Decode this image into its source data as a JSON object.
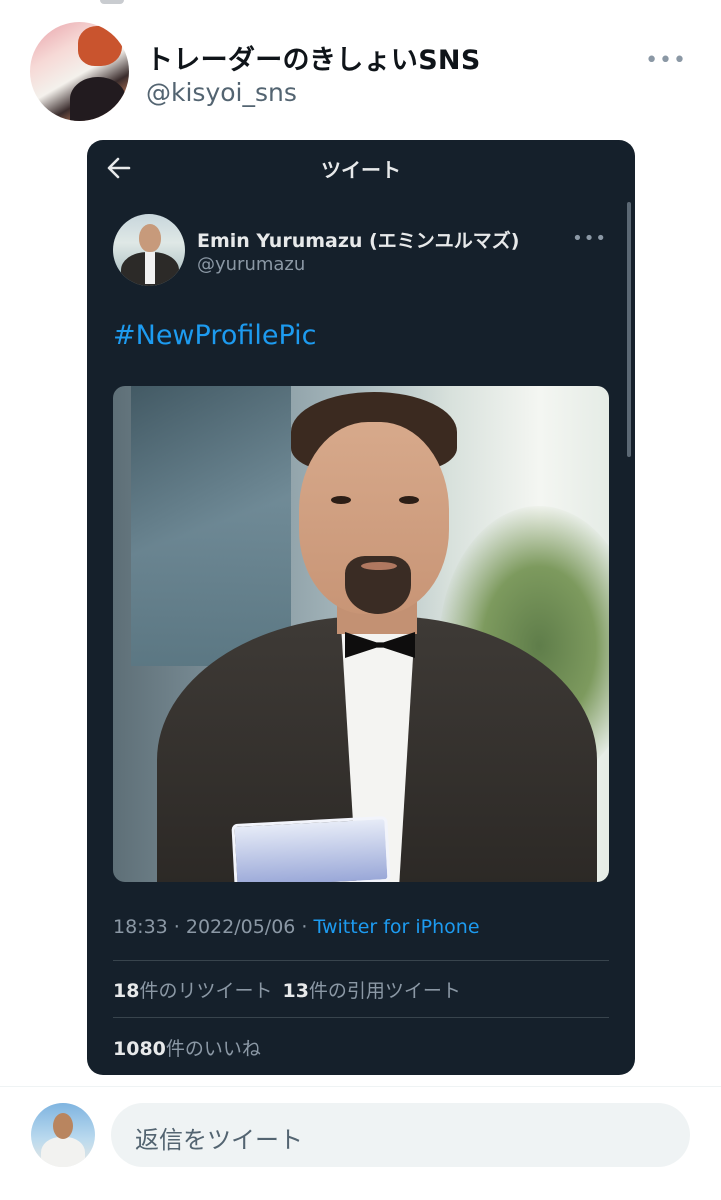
{
  "outer_tweet": {
    "display_name": "トレーダーのきしょいSNS",
    "handle": "@kisyoi_sns",
    "more_icon": "more-horizontal-icon"
  },
  "embedded_screenshot": {
    "title": "ツイート",
    "back_icon": "arrow-left-icon",
    "tweet": {
      "display_name": "Emin Yurumazu (エミンユルマズ)",
      "handle": "@yurumazu",
      "more_icon": "more-horizontal-icon",
      "text": "#NewProfilePic",
      "timestamp": "18:33 · 2022/05/06 · ",
      "client": "Twitter for iPhone",
      "retweets": {
        "count": "18",
        "label": "件のリツイート"
      },
      "quotes": {
        "count": "13",
        "label": "件の引用ツイート"
      },
      "likes": {
        "count": "1080",
        "label": "件のいいね"
      }
    },
    "colors": {
      "background": "#15202b",
      "link": "#1d9bf0",
      "secondary": "#8b98a5",
      "primary": "#e7e9ea"
    }
  },
  "reply": {
    "placeholder": "返信をツイート"
  }
}
